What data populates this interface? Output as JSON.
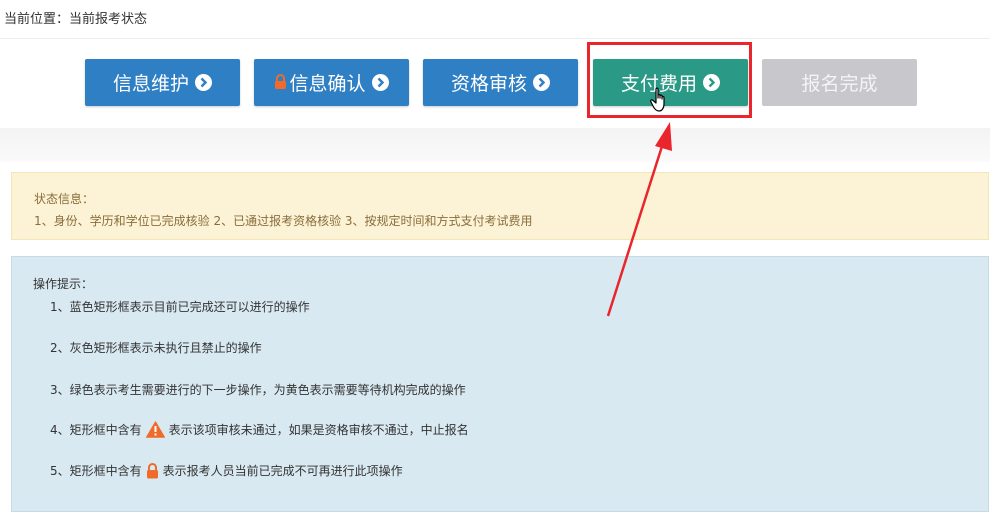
{
  "breadcrumb": "当前位置：当前报考状态",
  "steps": [
    {
      "label": "信息维护",
      "state": "done",
      "color": "#2f7fc4"
    },
    {
      "label": "信息确认",
      "state": "locked",
      "color": "#2f7fc4"
    },
    {
      "label": "资格审核",
      "state": "done",
      "color": "#2f7fc4"
    },
    {
      "label": "支付费用",
      "state": "current",
      "color": "#2a9a86"
    },
    {
      "label": "报名完成",
      "state": "disabled",
      "color": "#c8c8cc"
    }
  ],
  "status": {
    "title": "状态信息：",
    "text": "1、身份、学历和学位已完成核验 2、已通过报考资格核验 3、按规定时间和方式支付考试费用"
  },
  "tips": {
    "title": "操作提示：",
    "items": [
      {
        "prefix": "1、蓝色矩形框表示目前已完成还可以进行的操作",
        "icon": "",
        "suffix": ""
      },
      {
        "prefix": "2、灰色矩形框表示未执行且禁止的操作",
        "icon": "",
        "suffix": ""
      },
      {
        "prefix": "3、绿色表示考生需要进行的下一步操作，为黄色表示需要等待机构完成的操作",
        "icon": "",
        "suffix": ""
      },
      {
        "prefix": "4、矩形框中含有",
        "icon": "warning-icon",
        "suffix": "表示该项审核未通过，如果是资格审核不通过，中止报名"
      },
      {
        "prefix": "5、矩形框中含有",
        "icon": "lock-icon",
        "suffix": "表示报考人员当前已完成不可再进行此项操作"
      }
    ]
  },
  "colors": {
    "highlight": "#e8262c",
    "status_bg": "#fcf3d6",
    "tips_bg": "#d8e9f1"
  }
}
